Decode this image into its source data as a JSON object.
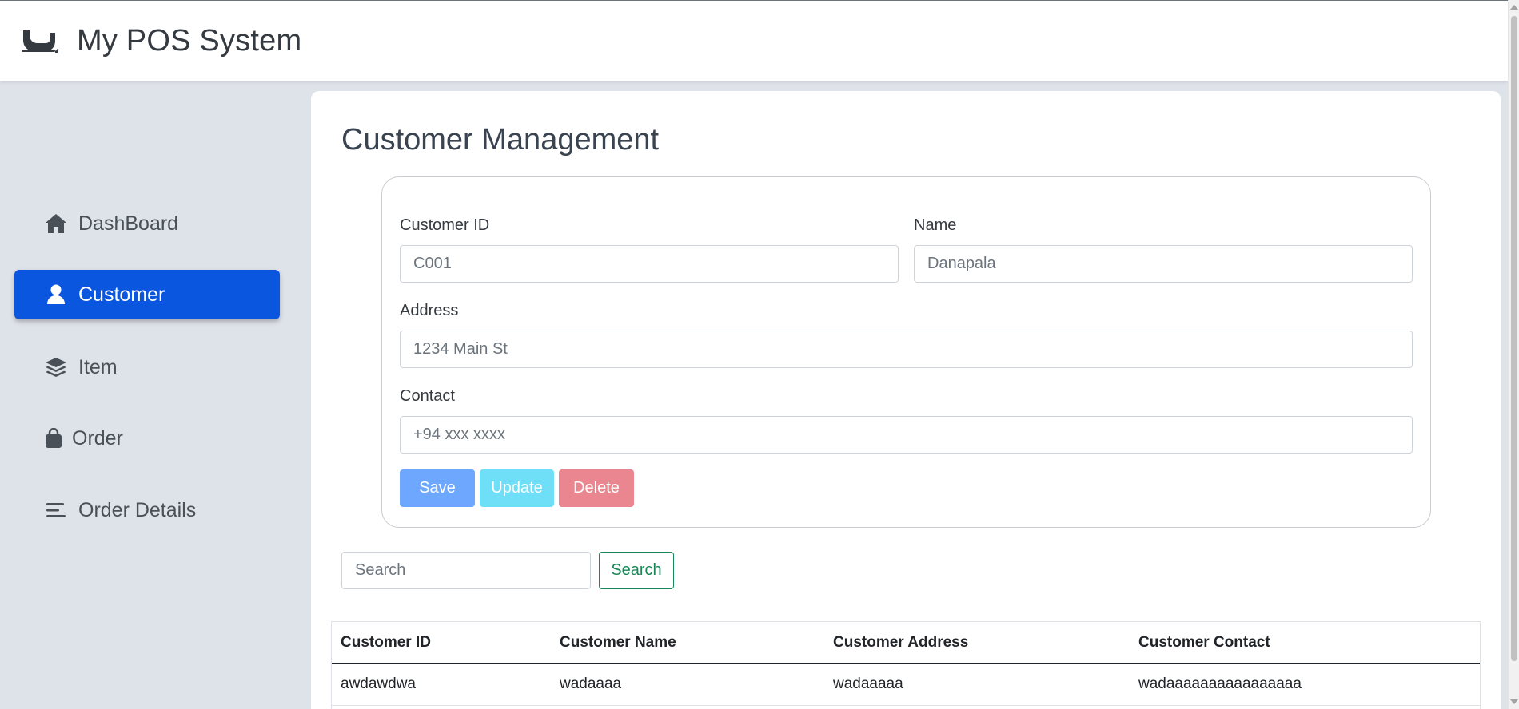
{
  "app": {
    "title": "My POS System",
    "logo_icon": "sleigh-icon"
  },
  "sidebar": {
    "items": [
      {
        "label": "DashBoard",
        "icon": "home-icon",
        "active": false
      },
      {
        "label": "Customer",
        "icon": "user-icon",
        "active": true
      },
      {
        "label": "Item",
        "icon": "layers-icon",
        "active": false
      },
      {
        "label": "Order",
        "icon": "shopping-bag-icon",
        "active": false
      },
      {
        "label": "Order Details",
        "icon": "bars-icon",
        "active": false
      }
    ]
  },
  "main": {
    "title": "Customer Management",
    "form": {
      "customer_id": {
        "label": "Customer ID",
        "placeholder": "C001",
        "value": ""
      },
      "name": {
        "label": "Name",
        "placeholder": "Danapala",
        "value": ""
      },
      "address": {
        "label": "Address",
        "placeholder": "1234 Main St",
        "value": ""
      },
      "contact": {
        "label": "Contact",
        "placeholder": "+94 xxx xxxx",
        "value": ""
      },
      "buttons": {
        "save": "Save",
        "update": "Update",
        "delete": "Delete"
      }
    },
    "search": {
      "placeholder": "Search",
      "button": "Search"
    },
    "table": {
      "columns": [
        "Customer ID",
        "Customer Name",
        "Customer Address",
        "Customer Contact"
      ],
      "rows": [
        [
          "awdawdwa",
          "wadaaaa",
          "wadaaaaa",
          "wadaaaaaaaaaaaaaaaa"
        ]
      ]
    }
  },
  "colors": {
    "sidebar_bg": "#dee2e9",
    "active_nav": "#0b56de",
    "save": "#6ea8fe",
    "update": "#6edff6",
    "delete": "#ea868f",
    "search_outline": "#198754"
  }
}
